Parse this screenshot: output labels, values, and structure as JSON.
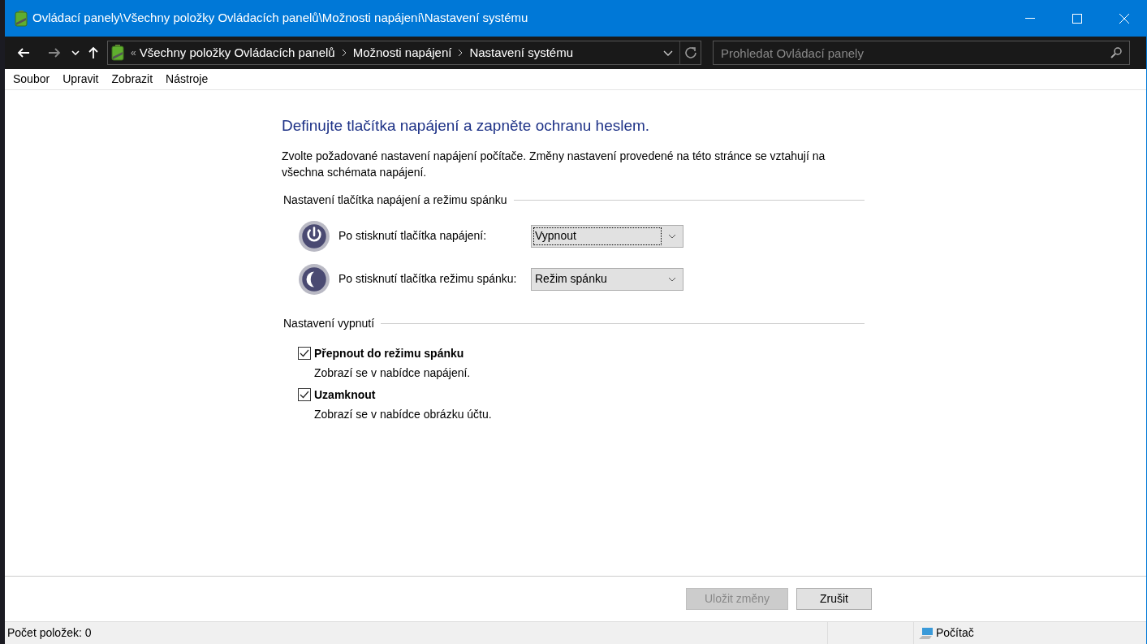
{
  "window": {
    "title": "Ovládací panely\\Všechny položky Ovládacích panelů\\Možnosti napájení\\Nastavení systému"
  },
  "address_bar": {
    "overflow": "«",
    "crumbs": [
      "Všechny položky Ovládacích panelů",
      "Možnosti napájení",
      "Nastavení systému"
    ]
  },
  "search": {
    "placeholder": "Prohledat Ovládací panely"
  },
  "menu": [
    "Soubor",
    "Upravit",
    "Zobrazit",
    "Nástroje"
  ],
  "heading": "Definujte tlačítka napájení a zapněte ochranu heslem.",
  "description": "Zvolte požadované nastavení napájení počítače. Změny nastavení provedené na této stránce se vztahují na všechna schémata napájení.",
  "button_section": {
    "title": "Nastavení tlačítka napájení a režimu spánku",
    "rows": [
      {
        "kind": "power",
        "label": "Po stisknutí tlačítka napájení:",
        "value": "Vypnout",
        "focused": true
      },
      {
        "kind": "sleep",
        "label": "Po stisknutí tlačítka režimu spánku:",
        "value": "Režim spánku",
        "focused": false
      }
    ]
  },
  "shutdown_section": {
    "title": "Nastavení vypnutí",
    "options": [
      {
        "label": "Přepnout do režimu spánku",
        "hint": "Zobrazí se v nabídce napájení.",
        "checked": true
      },
      {
        "label": "Uzamknout",
        "hint": "Zobrazí se v nabídce obrázku účtu.",
        "checked": true
      }
    ]
  },
  "buttons": [
    {
      "label": "Uložit změny",
      "disabled": true
    },
    {
      "label": "Zrušit",
      "disabled": false
    }
  ],
  "status_bar": {
    "count": "Počet položek: 0",
    "location": "Počítač"
  }
}
